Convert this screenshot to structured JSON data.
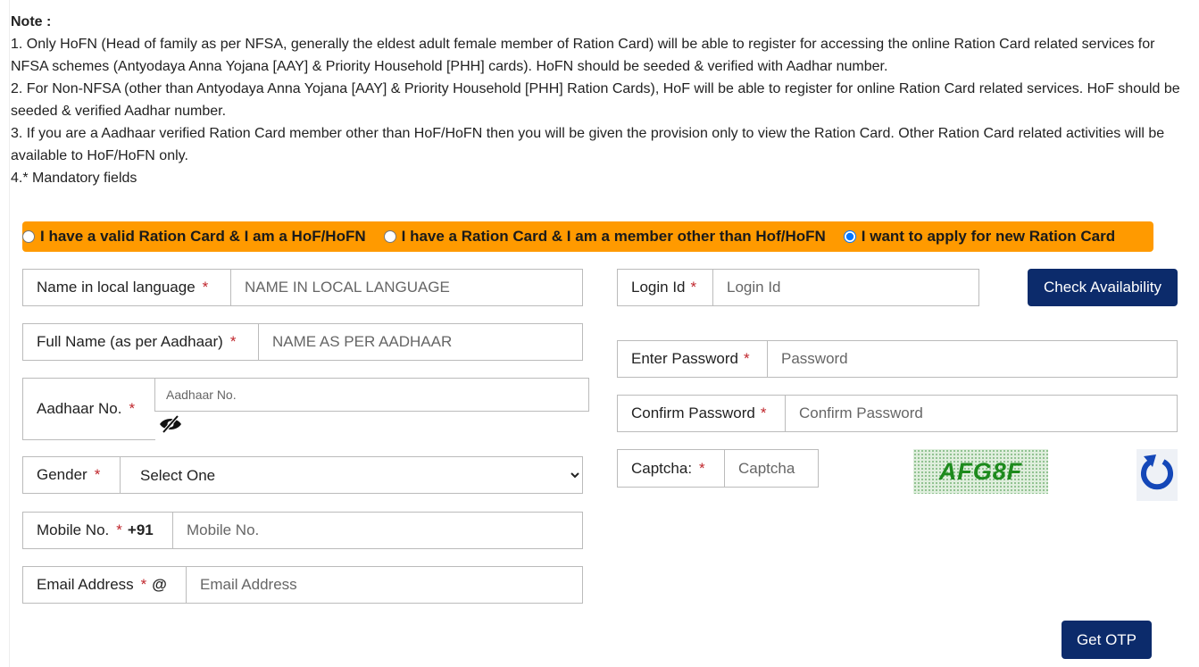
{
  "note": {
    "title": "Note :",
    "lines": [
      "1. Only HoFN (Head of family as per NFSA, generally the eldest adult female member of Ration Card) will be able to register for accessing the online Ration Card related services for NFSA schemes (Antyodaya Anna Yojana [AAY] & Priority Household [PHH] cards). HoFN should be seeded & verified with Aadhar number.",
      "2. For Non-NFSA (other than Antyodaya Anna Yojana [AAY] & Priority Household [PHH] Ration Cards), HoF will be able to register for online Ration Card related services. HoF should be seeded & verified Aadhar number.",
      "3. If you are a Aadhaar verified Ration Card member other than HoF/HoFN then you will be given the provision only to view the Ration Card. Other Ration Card related activities will be available to HoF/HoFN only.",
      "4.* Mandatory fields"
    ]
  },
  "options": [
    {
      "label": "I have a valid Ration Card & I am a HoF/HoFN",
      "checked": false
    },
    {
      "label": "I have a Ration Card & I am a member other than Hof/HoFN",
      "checked": false
    },
    {
      "label": "I want to apply for new Ration Card",
      "checked": true
    }
  ],
  "colors": {
    "bar": "#ff9a00",
    "button": "#0c2b6b",
    "required": "#c0262c"
  },
  "fields": {
    "local_name": {
      "label": "Name in local language",
      "placeholder": "NAME IN LOCAL LANGUAGE"
    },
    "full_name": {
      "label": "Full Name (as per Aadhaar)",
      "placeholder": "NAME AS PER AADHAAR"
    },
    "aadhaar": {
      "label": "Aadhaar No.",
      "placeholder": "Aadhaar No.",
      "icon": "eye-slash-icon"
    },
    "gender": {
      "label": "Gender",
      "value": "Select One"
    },
    "mobile": {
      "label": "Mobile No.",
      "prefix": "+91",
      "placeholder": "Mobile No."
    },
    "email": {
      "label": "Email Address",
      "prefix": "@",
      "placeholder": "Email Address"
    },
    "login": {
      "label": "Login Id",
      "placeholder": "Login Id"
    },
    "password": {
      "label": "Enter Password",
      "placeholder": "Password"
    },
    "confirm": {
      "label": "Confirm Password",
      "placeholder": "Confirm Password"
    },
    "captcha": {
      "label": "Captcha:",
      "placeholder": "Captcha",
      "image_text": "AFG8F",
      "refresh_icon": "refresh-icon"
    }
  },
  "required_mark": "*",
  "buttons": {
    "check": "Check Availability",
    "otp": "Get OTP"
  }
}
